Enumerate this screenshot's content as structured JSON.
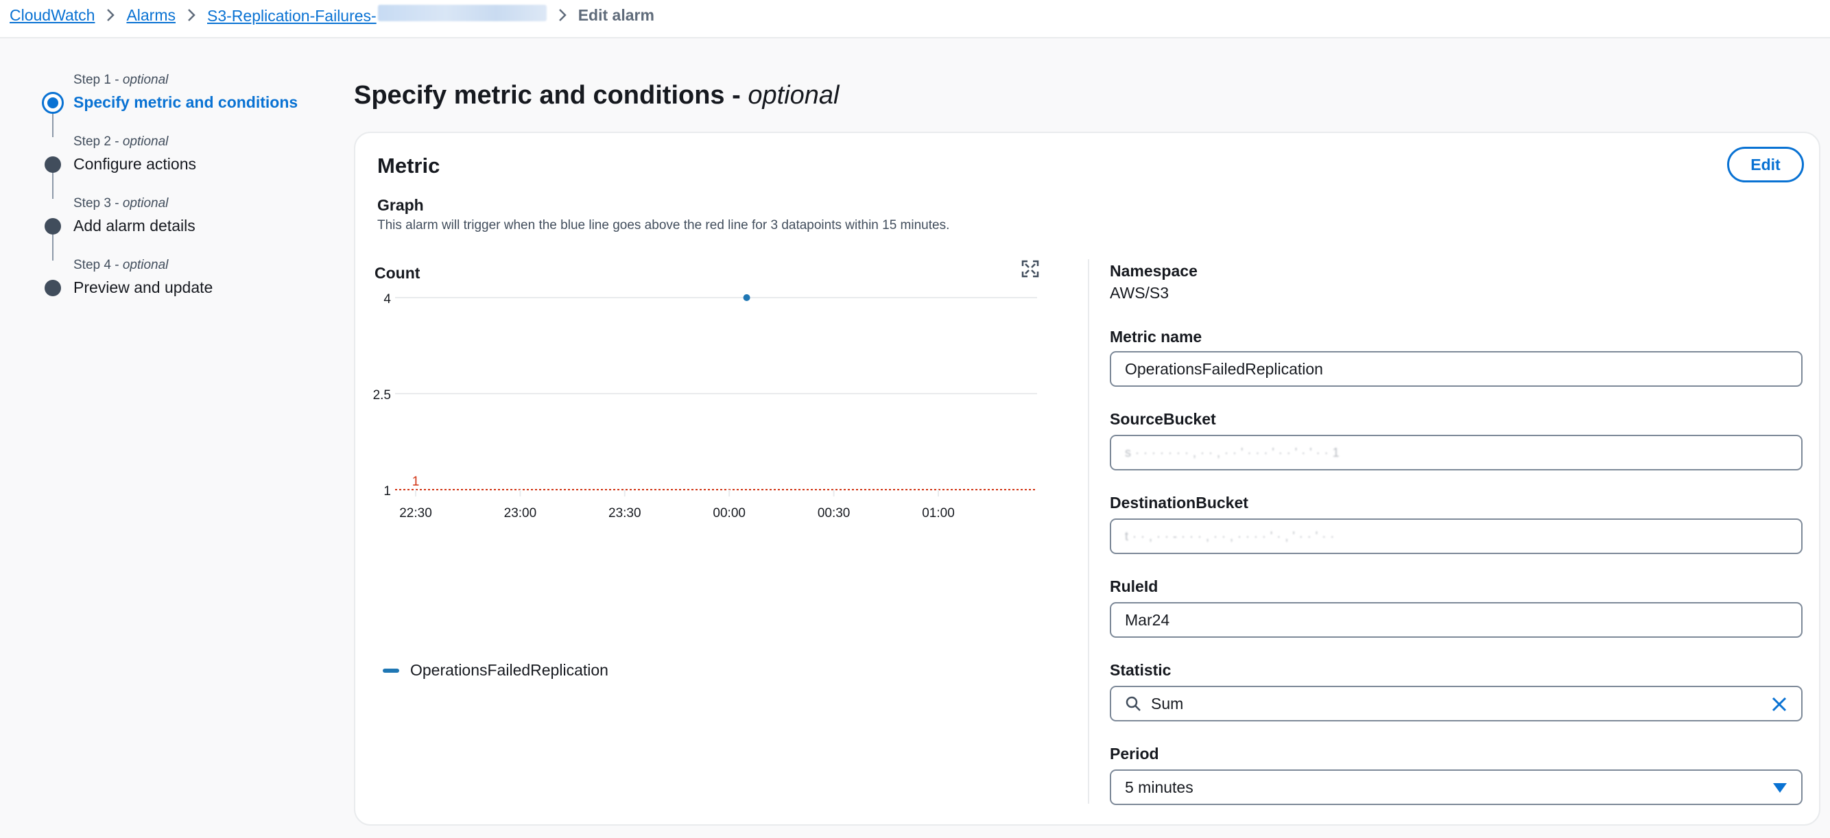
{
  "breadcrumb": {
    "items": [
      "CloudWatch",
      "Alarms",
      "S3-Replication-Failures-"
    ],
    "current": "Edit alarm"
  },
  "steps": [
    {
      "sub": "Step 1",
      "optional": "optional",
      "title": "Specify metric and conditions",
      "active": true
    },
    {
      "sub": "Step 2",
      "optional": "optional",
      "title": "Configure actions",
      "active": false
    },
    {
      "sub": "Step 3",
      "optional": "optional",
      "title": "Add alarm details",
      "active": false
    },
    {
      "sub": "Step 4",
      "optional": "optional",
      "title": "Preview and update",
      "active": false
    }
  ],
  "page": {
    "title": "Specify metric and conditions -",
    "title_optional": "optional"
  },
  "metric_card": {
    "title": "Metric",
    "edit_label": "Edit",
    "graph_title": "Graph",
    "graph_description": "This alarm will trigger when the blue line goes above the red line for 3 datapoints within 15 minutes."
  },
  "chart_data": {
    "type": "line",
    "ylabel": "Count",
    "yticks": [
      4,
      2.5,
      1
    ],
    "ylim": [
      1,
      4
    ],
    "xticks": [
      "22:30",
      "23:00",
      "23:30",
      "00:00",
      "00:30",
      "01:00"
    ],
    "series": [
      {
        "name": "OperationsFailedReplication",
        "color": "#1f77b4",
        "points": [
          {
            "x": "00:05",
            "y": 4
          }
        ]
      }
    ],
    "threshold": {
      "value": 1,
      "label": "1",
      "color": "#d13212"
    },
    "grid": true,
    "legend": "bottom-left"
  },
  "form": {
    "namespace_label": "Namespace",
    "namespace_value": "AWS/S3",
    "metric_name_label": "Metric name",
    "metric_name_value": "OperationsFailedReplication",
    "source_bucket_label": "SourceBucket",
    "source_bucket_value": "s·······,··,··'···'··'·'··1",
    "destination_bucket_label": "DestinationBucket",
    "destination_bucket_value": "t··,··-···,··,····'·,'··'··",
    "rule_id_label": "RuleId",
    "rule_id_value": "Mar24",
    "statistic_label": "Statistic",
    "statistic_value": "Sum",
    "period_label": "Period",
    "period_value": "5 minutes"
  },
  "colors": {
    "accent": "#0972d3",
    "threshold": "#d13212",
    "series": "#1f77b4"
  },
  "icons": [
    "chevron-right-icon",
    "expand-icon",
    "search-icon",
    "close-icon",
    "caret-down-icon"
  ]
}
